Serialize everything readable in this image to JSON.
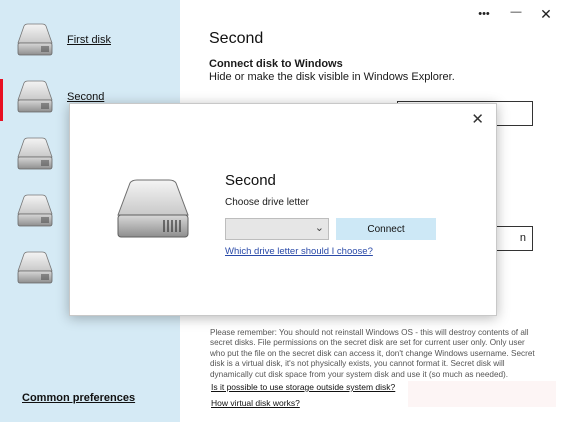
{
  "window": {
    "more_label": "•••",
    "minimize_label": "—",
    "close_label": "✕"
  },
  "sidebar": {
    "items": [
      {
        "label": "First disk"
      },
      {
        "label": "Second"
      },
      {
        "label": ""
      },
      {
        "label": ""
      },
      {
        "label": ""
      }
    ],
    "selected_index": 1,
    "common_preferences": "Common preferences"
  },
  "main": {
    "title": "Second",
    "connect_heading": "Connect disk to Windows",
    "connect_desc": "Hide or make the disk visible in Windows Explorer.",
    "partial_button_label": "n",
    "notice": "Please remember: You should not reinstall Windows OS - this will destroy contents of all secret disks. File permissions on the secret disk are set for current user only. Only user who put the file on the secret disk can access it, don't change Windows username. Secret disk is a virtual disk, it's not physically exists, you cannot format it. Secret disk will dynamically cut disk space from your system disk and use it (so much as needed).",
    "link_storage": "Is it possible to use storage outside system disk?",
    "link_how": "How virtual disk works?"
  },
  "dialog": {
    "close_label": "✕",
    "title": "Second",
    "subtitle": "Choose drive letter",
    "select_value": "",
    "connect_label": "Connect",
    "help_link": "Which drive letter should I choose?"
  },
  "colors": {
    "sidebar_bg": "#d5eaf5",
    "selection_marker": "#e81123",
    "connect_button": "#cde8f6",
    "link": "#2a4aa8"
  },
  "icons": {
    "disk": "hard-disk-icon",
    "chevron": "chevron-down-icon",
    "close": "close-icon",
    "more": "more-icon",
    "minimize": "minimize-icon"
  }
}
